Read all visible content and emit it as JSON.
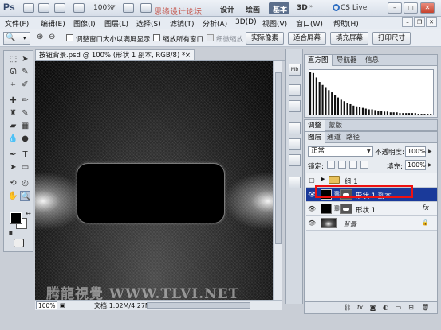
{
  "titlebar": {
    "logo": "Ps",
    "zoom": "100%",
    "watermark": "思缘设计论坛",
    "workspaces": [
      "设计",
      "绘画",
      "基本"
    ],
    "three_d": "3D",
    "cslive": "CS Live",
    "min": "–",
    "max": "□",
    "close": "✕"
  },
  "menu": {
    "items": [
      "文件(F)",
      "编辑(E)",
      "图像(I)",
      "图层(L)",
      "选择(S)",
      "滤镜(T)",
      "分析(A)",
      "3D(D)",
      "视图(V)",
      "窗口(W)",
      "帮助(H)"
    ]
  },
  "options": {
    "resize_windows": "调整窗口大小以满屏显示",
    "zoom_all": "缩放所有窗口",
    "scrubby_zoom": "细微缩放",
    "actual_pixels": "实际像素",
    "fit_screen": "适合屏幕",
    "fill_screen": "填充屏幕",
    "print_size": "打印尺寸"
  },
  "document": {
    "tab_title": "按钮背景.psd @ 100% (形状 1 副本, RGB/8) *",
    "tab_close": "×",
    "zoom": "100%",
    "info": "文档:1.02M/4.27M",
    "watermark": "腾龍視覺 WWW.TLVI.NET"
  },
  "panel_strip": [
    "Mb",
    "",
    "",
    "",
    "",
    "",
    ""
  ],
  "histogram_panel": {
    "tabs": [
      "直方图",
      "导航器",
      "信息"
    ],
    "histogram": [
      58,
      56,
      50,
      44,
      40,
      36,
      33,
      30,
      26,
      23,
      20,
      18,
      16,
      14,
      12,
      11,
      10,
      9,
      8,
      7,
      7,
      6,
      5,
      5,
      4,
      4,
      3,
      3,
      3,
      2,
      2,
      2,
      2,
      2,
      2,
      1,
      1,
      1,
      1,
      1
    ]
  },
  "adjustments_panel": {
    "tabs": [
      "调整",
      "蒙版"
    ]
  },
  "layers_panel": {
    "tabs": [
      "图层",
      "通道",
      "路径"
    ],
    "blend_mode": "正常",
    "opacity_label": "不透明度:",
    "opacity": "100%",
    "lock_label": "锁定:",
    "fill_label": "填充:",
    "fill": "100%",
    "layers": [
      {
        "name": "组 1",
        "type": "group",
        "selected": false
      },
      {
        "name": "形状 1 副本",
        "type": "shape",
        "selected": true
      },
      {
        "name": "形状 1",
        "type": "shape",
        "selected": false,
        "fx": "fx"
      },
      {
        "name": "背景",
        "type": "background",
        "selected": false
      }
    ]
  },
  "colors": {
    "selection": "#1a3a9a",
    "highlight_outline": "#ee1111",
    "foreground": "#000000",
    "background": "#ffffff"
  }
}
